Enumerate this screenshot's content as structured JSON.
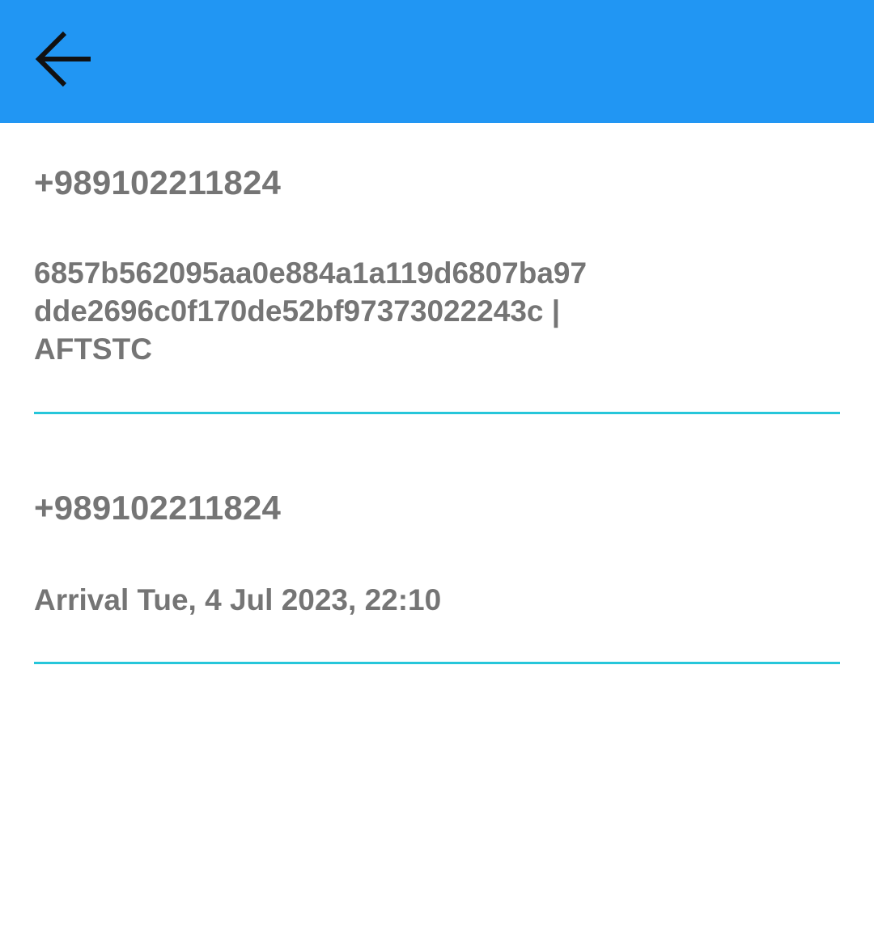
{
  "app_bar": {
    "back_icon": "arrow-left-icon",
    "color": "#2196F3"
  },
  "accent_color": "#26C6DA",
  "messages": [
    {
      "sender": "+989102211824",
      "body_lines": [
        "6857b562095aa0e884a1a119d6807ba97",
        "dde2696c0f170de52bf97373022243c |",
        "AFTSTC"
      ]
    },
    {
      "sender": "+989102211824",
      "body_lines": [
        "Arrival Tue, 4 Jul 2023, 22:10"
      ]
    }
  ]
}
